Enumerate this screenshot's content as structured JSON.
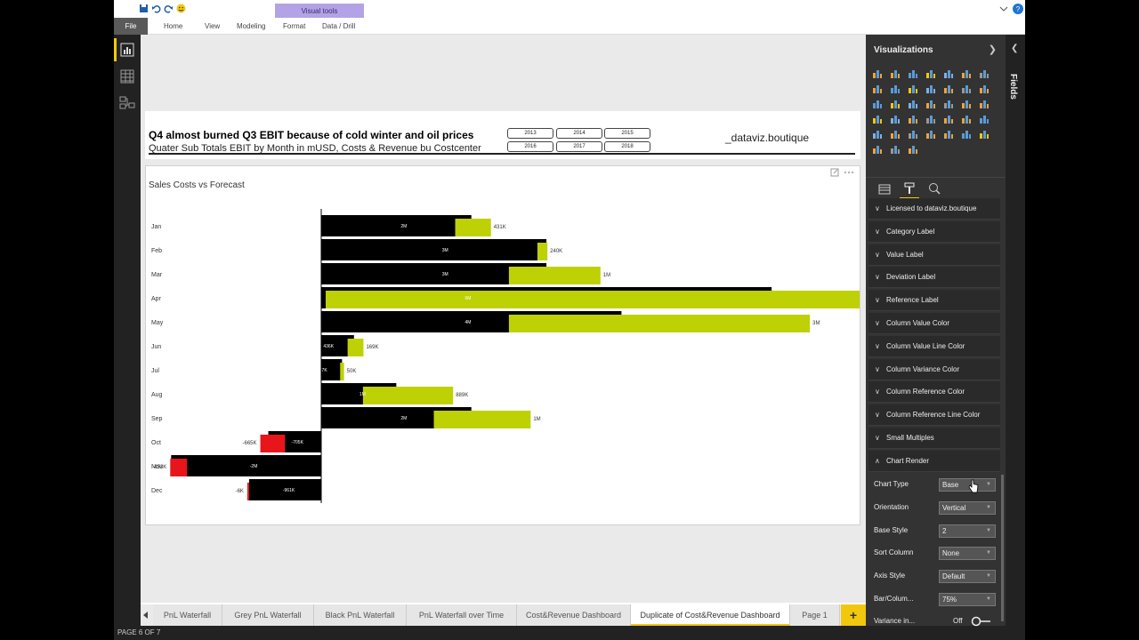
{
  "ribbon": {
    "visual_tools": "Visual tools",
    "tabs": [
      "File",
      "Home",
      "View",
      "Modeling",
      "Format",
      "Data / Drill"
    ]
  },
  "report": {
    "title": "Q4 almost burned Q3 EBIT because of cold winter and oil prices",
    "subtitle": "Quater Sub Totals EBIT by Month in mUSD, Costs & Revenue bu Costcenter",
    "brand": "_dataviz.boutique",
    "years": [
      "2013",
      "2014",
      "2015",
      "2016",
      "2017",
      "2018"
    ]
  },
  "chart_data": {
    "type": "bar",
    "title": "Sales Costs vs Forecast",
    "categories": [
      "Jan",
      "Feb",
      "Mar",
      "Apr",
      "May",
      "Jun",
      "Jul",
      "Aug",
      "Sep",
      "Oct",
      "Nov",
      "Dec"
    ],
    "base_labels": [
      "2M",
      "3M",
      "3M",
      "6M",
      "4M",
      "436K",
      "277K",
      "1M",
      "2M",
      "-705K",
      "-2M",
      "-961K"
    ],
    "variance_labels": [
      "431K",
      "240K",
      "1M",
      "6M",
      "3M",
      "169K",
      "50K",
      "889K",
      "1M",
      "-665K",
      "-453K",
      "-6K"
    ],
    "colors": {
      "base": "#000000",
      "positive": "#bed105",
      "negative": "#e8151b"
    }
  },
  "viz_pane": {
    "title": "Visualizations",
    "sections": [
      "Licensed to dataviz.boutique",
      "Category Label",
      "Value Label",
      "Deviation Label",
      "Reference Label",
      "Column Value Color",
      "Column Value Line Color",
      "Column Variance Color",
      "Column Reference Color",
      "Column Reference Line Color",
      "Small Multiples",
      "Chart Render"
    ],
    "props": [
      {
        "label": "Chart Type",
        "value": "Base"
      },
      {
        "label": "Orientation",
        "value": "Vertical"
      },
      {
        "label": "Base Style",
        "value": "2"
      },
      {
        "label": "Sort Column",
        "value": "None"
      },
      {
        "label": "Axis Style",
        "value": "Default"
      },
      {
        "label": "Bar/Colum...",
        "value": "75%"
      }
    ],
    "variance_label": "Variance in...",
    "variance_value": "Off"
  },
  "fields_label": "Fields",
  "pages": [
    "PnL Waterfall",
    "Grey PnL Waterfall",
    "Black PnL Waterfall",
    "PnL Waterfall over Time",
    "Cost&Revenue Dashboard",
    "Duplicate of Cost&Revenue Dashboard",
    "Page 1"
  ],
  "active_page_index": 5,
  "status": "PAGE 6 OF 7"
}
